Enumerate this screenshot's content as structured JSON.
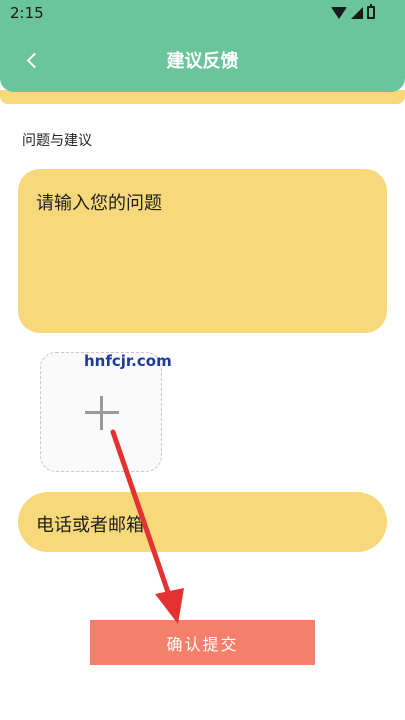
{
  "status_bar": {
    "time": "2:15"
  },
  "app_bar": {
    "title": "建议反馈"
  },
  "form": {
    "section_label": "问题与建议",
    "question_placeholder": "请输入您的问题",
    "contact_placeholder": "电话或者邮箱",
    "submit_label": "确认提交"
  },
  "watermark": "hnfcjr.com",
  "icons": {
    "back": "chevron-left-icon",
    "add_image": "plus-icon",
    "annotation": "red-arrow"
  },
  "colors": {
    "app_bar": "#6ac59a",
    "input_background": "#f7d87a",
    "submit_button": "#f47f6b",
    "annotation_arrow": "#e23232"
  }
}
